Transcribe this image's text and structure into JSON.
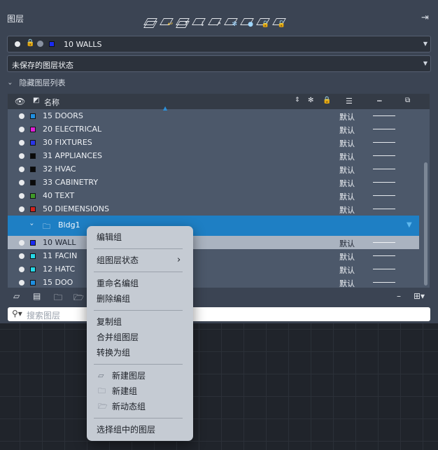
{
  "panel": {
    "title": "图层",
    "current_layer": {
      "name": "10 WALLS",
      "color": "#1a2bf2"
    },
    "layer_state": "未保存的图层状态",
    "hide_list_label": "隐藏图层列表",
    "header": {
      "name_col": "名称"
    },
    "search_placeholder": "搜索图层"
  },
  "layers": [
    {
      "name": "15 DOORS",
      "color": "#1f8fe0",
      "default": "默认"
    },
    {
      "name": "20 ELECTRICAL",
      "color": "#e020d8",
      "default": "默认"
    },
    {
      "name": "30 FIXTURES",
      "color": "#2a36e8",
      "default": "默认"
    },
    {
      "name": "31 APPLIANCES",
      "color": "#0a0a0a",
      "default": "默认"
    },
    {
      "name": "32 HVAC",
      "color": "#0a0a0a",
      "default": "默认"
    },
    {
      "name": "33 CABINETRY",
      "color": "#0a0a0a",
      "default": "默认"
    },
    {
      "name": "40 TEXT",
      "color": "#3f9a2a",
      "default": "默认"
    },
    {
      "name": "50 DIEMENSIONS",
      "color": "#d0241e",
      "default": "默认"
    }
  ],
  "group": {
    "name": "Bldg1"
  },
  "group_layers": [
    {
      "name": "10 WALL",
      "color": "#1a2bf2",
      "default": "默认"
    },
    {
      "name": "11 FACIN",
      "color": "#25d8e6",
      "default": "默认"
    },
    {
      "name": "12 HATC",
      "color": "#25d8e6",
      "default": "默认"
    },
    {
      "name": "15 DOO",
      "color": "#1f8fe0",
      "default": "默认"
    }
  ],
  "context_menu": {
    "edit_group": "编辑组",
    "group_layer_state": "组图层状态",
    "rename_group": "重命名编组",
    "delete_group": "删除编组",
    "copy_group": "复制组",
    "merge_group_layers": "合并组图层",
    "convert_to_group": "转换为组",
    "new_layer": "新建图层",
    "new_group": "新建组",
    "new_dynamic_group": "新动态组",
    "select_group_layers": "选择组中的图层"
  },
  "colors": {
    "panel": "#3b4453",
    "selection": "#1e7fc4",
    "menu": "#c5cbd3"
  }
}
